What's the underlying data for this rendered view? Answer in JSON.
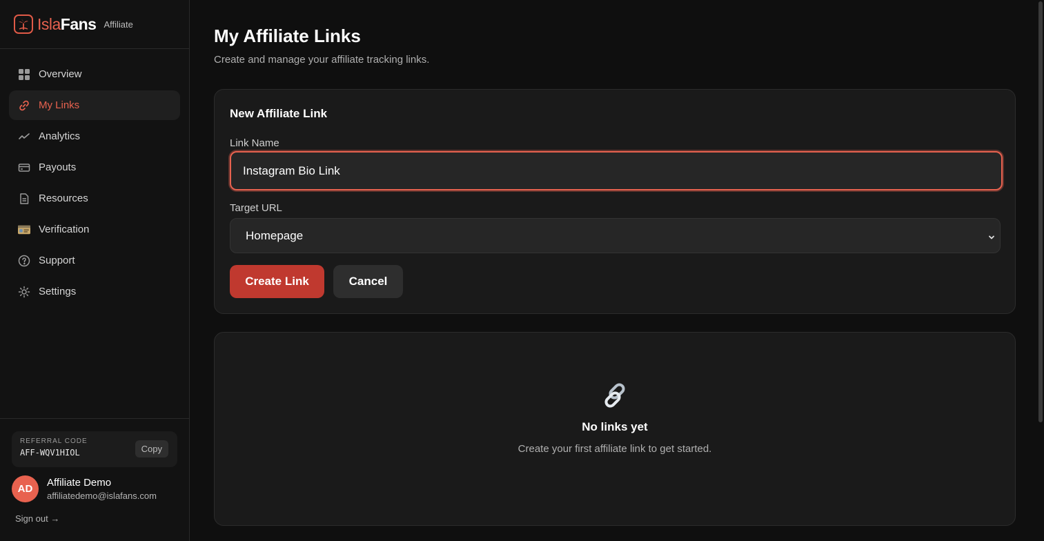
{
  "brand": {
    "part1": "Isla",
    "part2": "Fans",
    "tag": "Affiliate"
  },
  "sidebar": {
    "items": [
      {
        "label": "Overview",
        "icon": "grid-icon",
        "active": false
      },
      {
        "label": "My Links",
        "icon": "link-icon",
        "active": true
      },
      {
        "label": "Analytics",
        "icon": "trend-icon",
        "active": false
      },
      {
        "label": "Payouts",
        "icon": "card-icon",
        "active": false
      },
      {
        "label": "Resources",
        "icon": "document-icon",
        "active": false
      },
      {
        "label": "Verification",
        "icon": "id-card-icon",
        "active": false
      },
      {
        "label": "Support",
        "icon": "help-icon",
        "active": false
      },
      {
        "label": "Settings",
        "icon": "gear-icon",
        "active": false
      }
    ],
    "referral": {
      "label": "REFERRAL CODE",
      "code": "AFF-WQV1HIOL",
      "copy_label": "Copy"
    },
    "user": {
      "initials": "AD",
      "name": "Affiliate Demo",
      "email": "affiliatedemo@islafans.com"
    },
    "signout_label": "Sign out →"
  },
  "page": {
    "title": "My Affiliate Links",
    "subtitle": "Create and manage your affiliate tracking links."
  },
  "form": {
    "title": "New Affiliate Link",
    "name_label": "Link Name",
    "name_value": "Instagram Bio Link",
    "url_label": "Target URL",
    "url_selected": "Homepage",
    "create_label": "Create Link",
    "cancel_label": "Cancel"
  },
  "empty": {
    "title": "No links yet",
    "subtitle": "Create your first affiliate link to get started."
  },
  "colors": {
    "accent": "#e8624f",
    "primary_button": "#c0392f",
    "background": "#0f0f0f"
  }
}
